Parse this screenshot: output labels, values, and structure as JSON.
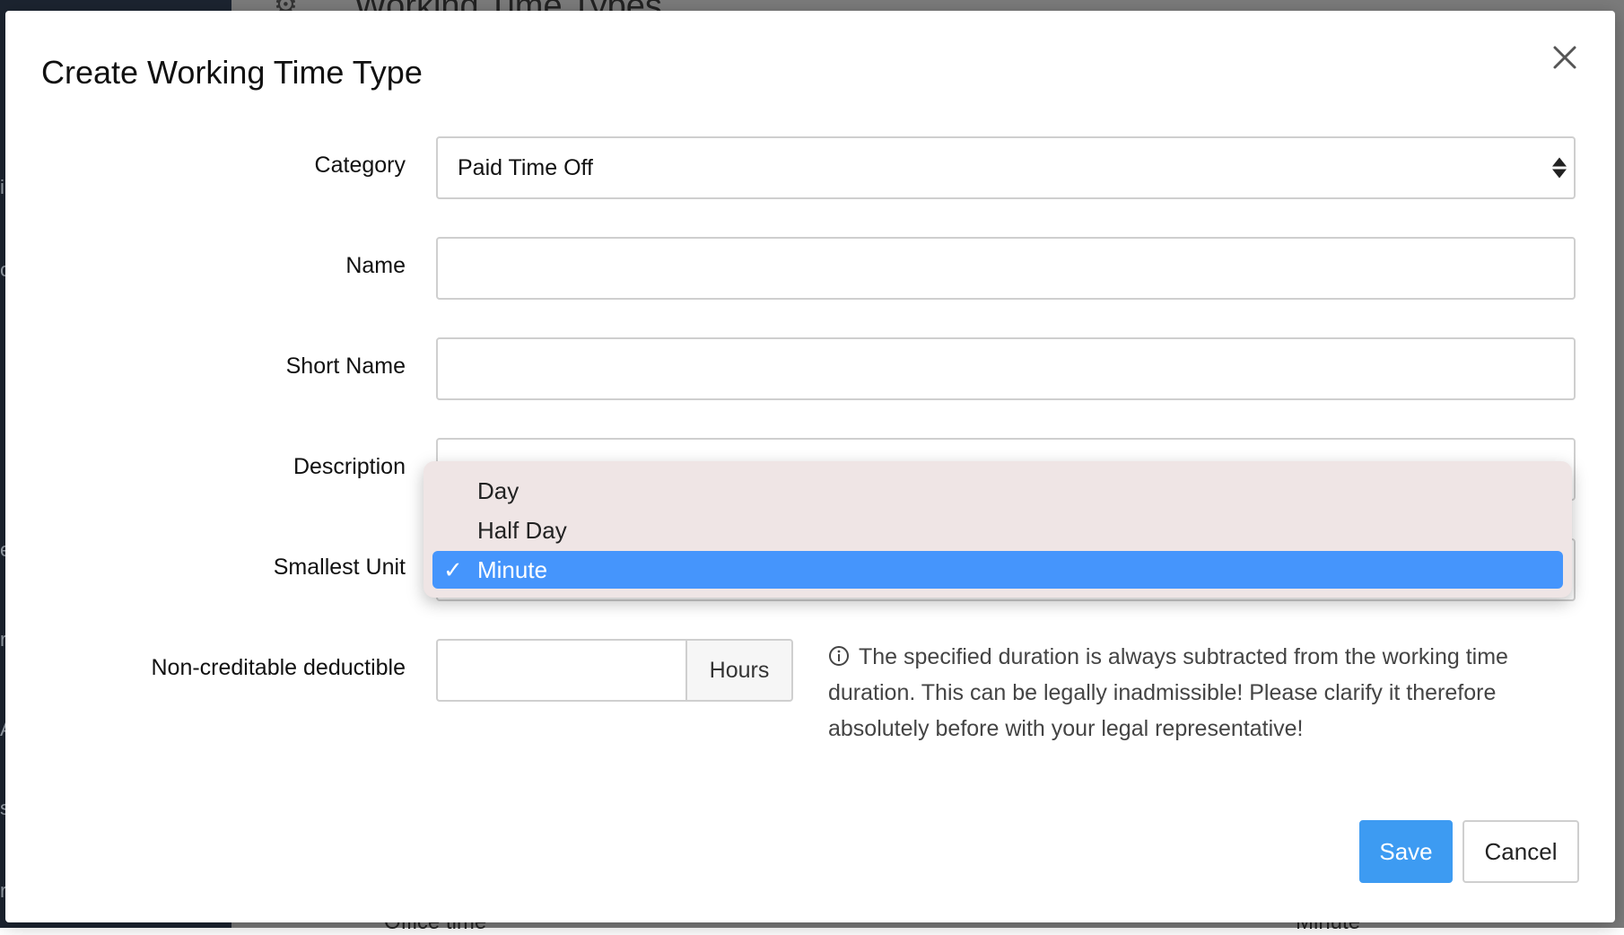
{
  "background": {
    "page_title": "Working Time Types",
    "table_row_label": "Office time",
    "table_row_unit": "Minute"
  },
  "modal": {
    "title": "Create Working Time Type",
    "close_icon": "close-icon"
  },
  "form": {
    "category": {
      "label": "Category",
      "value": "Paid Time Off"
    },
    "name": {
      "label": "Name",
      "value": ""
    },
    "short_name": {
      "label": "Short Name",
      "value": ""
    },
    "description": {
      "label": "Description",
      "value": ""
    },
    "smallest_unit": {
      "label": "Smallest Unit",
      "options": [
        "Day",
        "Half Day",
        "Minute"
      ],
      "selected": "Minute",
      "check_mark": "✓"
    },
    "deductible": {
      "label": "Non-creditable deductible",
      "value": "",
      "addon": "Hours",
      "help": "The specified duration is always subtracted from the working time duration. This can be legally inadmissible! Please clarify it therefore absolutely before with your legal representative!"
    }
  },
  "actions": {
    "save": "Save",
    "cancel": "Cancel"
  },
  "colors": {
    "primary": "#3d9bf2",
    "dropdown_selected": "#4595fc",
    "dropdown_bg": "#efe5e5"
  }
}
